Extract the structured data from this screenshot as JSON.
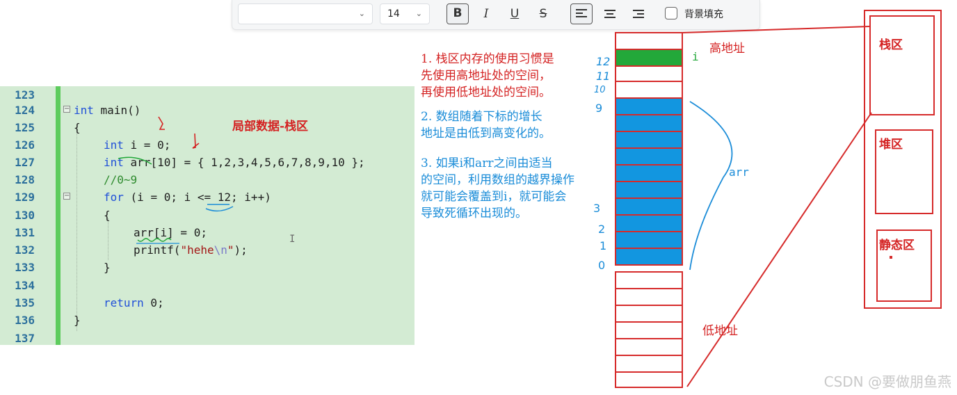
{
  "toolbar": {
    "font_name": "",
    "font_size": "14",
    "bold": "B",
    "italic": "I",
    "underline": "U",
    "strike": "S",
    "bg_fill_label": "背景填充"
  },
  "code": {
    "lines": [
      {
        "n": "123"
      },
      {
        "n": "124"
      },
      {
        "n": "125"
      },
      {
        "n": "126"
      },
      {
        "n": "127"
      },
      {
        "n": "128"
      },
      {
        "n": "129"
      },
      {
        "n": "130"
      },
      {
        "n": "131"
      },
      {
        "n": "132"
      },
      {
        "n": "133"
      },
      {
        "n": "134"
      },
      {
        "n": "135"
      },
      {
        "n": "136"
      },
      {
        "n": "137"
      }
    ],
    "t124a": "int",
    "t124b": " main()",
    "t125": "{",
    "t126a": "int",
    "t126b": " i = 0;",
    "t127a": "int",
    "t127b": " arr[10] = { 1,2,3,4,5,6,7,8,9,10 };",
    "t128": "//0~9",
    "t129a": "for",
    "t129b": " (i = 0; i <= 12; i++)",
    "t130": "{",
    "t131": "arr[i] = 0;",
    "t132a": "printf(",
    "t132b": "\"hehe",
    "t132c": "\\n",
    "t132d": "\"",
    "t132e": ");",
    "t133": "}",
    "t135a": "return",
    "t135b": " 0;",
    "t136": "}"
  },
  "annotations": {
    "local_data": "局部数据-栈区",
    "note1": [
      "1. 栈区内存的使用习惯是",
      "先使用高地址处的空间，",
      "再使用低地址处的空间。"
    ],
    "note2": [
      "2. 数组随着下标的增长",
      "地址是由低到高变化的。"
    ],
    "note3": [
      "3. 如果i和arr之间由适当",
      "的空间，利用数组的越界操作",
      "就可能会覆盖到i，就可能会",
      "导致死循环出现的。"
    ],
    "high_addr": "高地址",
    "low_addr": "低地址",
    "i_label": "i",
    "arr_label": "arr",
    "indices": [
      "12",
      "11",
      "10",
      "9",
      "3",
      "2",
      "1",
      "0"
    ]
  },
  "memory": {
    "stack": "栈区",
    "heap": "堆区",
    "static": "静态区"
  },
  "colors": {
    "code_bg": "#d3ebd3",
    "annotation_red": "#d42222",
    "annotation_blue": "#1a8cd8",
    "array_cell": "#1296e0",
    "i_cell": "#23a83a"
  },
  "watermark": "CSDN @要做朋鱼燕"
}
